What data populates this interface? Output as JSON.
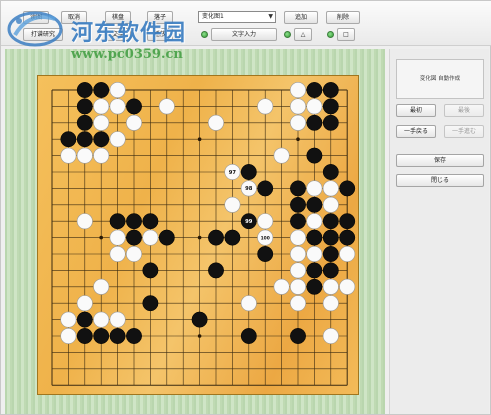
{
  "toolbar": {
    "btn_open": "读图",
    "btn_cancel": "取消",
    "btn_tab_a": "棋盘",
    "btn_tab_b": "打谱研究",
    "btn_tab_c": "落子",
    "btn_play": "播放",
    "btn_extra": "交手",
    "select_value": "变化图1",
    "btn_add": "追加",
    "btn_delete": "削除",
    "btn_text_input": "文字入力",
    "shape_triangle": "△",
    "shape_square": "□"
  },
  "watermark": {
    "title": "河东软件园",
    "url": "www.pc0359.cn"
  },
  "board": {
    "size": 19,
    "stones": [
      {
        "c": "b",
        "x": 2,
        "y": 0
      },
      {
        "c": "b",
        "x": 3,
        "y": 0
      },
      {
        "c": "w",
        "x": 4,
        "y": 0
      },
      {
        "c": "w",
        "x": 15,
        "y": 0
      },
      {
        "c": "b",
        "x": 16,
        "y": 0
      },
      {
        "c": "b",
        "x": 17,
        "y": 0
      },
      {
        "c": "b",
        "x": 2,
        "y": 1
      },
      {
        "c": "w",
        "x": 3,
        "y": 1
      },
      {
        "c": "w",
        "x": 4,
        "y": 1
      },
      {
        "c": "b",
        "x": 5,
        "y": 1
      },
      {
        "c": "w",
        "x": 7,
        "y": 1
      },
      {
        "c": "w",
        "x": 13,
        "y": 1
      },
      {
        "c": "w",
        "x": 15,
        "y": 1
      },
      {
        "c": "w",
        "x": 16,
        "y": 1
      },
      {
        "c": "b",
        "x": 17,
        "y": 1
      },
      {
        "c": "b",
        "x": 2,
        "y": 2
      },
      {
        "c": "w",
        "x": 3,
        "y": 2
      },
      {
        "c": "w",
        "x": 5,
        "y": 2
      },
      {
        "c": "w",
        "x": 10,
        "y": 2
      },
      {
        "c": "w",
        "x": 15,
        "y": 2
      },
      {
        "c": "b",
        "x": 16,
        "y": 2
      },
      {
        "c": "b",
        "x": 17,
        "y": 2
      },
      {
        "c": "b",
        "x": 1,
        "y": 3
      },
      {
        "c": "b",
        "x": 2,
        "y": 3
      },
      {
        "c": "b",
        "x": 3,
        "y": 3
      },
      {
        "c": "w",
        "x": 4,
        "y": 3
      },
      {
        "c": "w",
        "x": 1,
        "y": 4
      },
      {
        "c": "w",
        "x": 2,
        "y": 4
      },
      {
        "c": "w",
        "x": 3,
        "y": 4
      },
      {
        "c": "w",
        "x": 14,
        "y": 4
      },
      {
        "c": "b",
        "x": 16,
        "y": 4
      },
      {
        "c": "w",
        "x": 11,
        "y": 5
      },
      {
        "c": "b",
        "x": 12,
        "y": 5
      },
      {
        "c": "b",
        "x": 17,
        "y": 5
      },
      {
        "c": "w",
        "x": 12,
        "y": 6
      },
      {
        "c": "b",
        "x": 13,
        "y": 6
      },
      {
        "c": "b",
        "x": 15,
        "y": 6
      },
      {
        "c": "w",
        "x": 16,
        "y": 6
      },
      {
        "c": "w",
        "x": 17,
        "y": 6
      },
      {
        "c": "b",
        "x": 18,
        "y": 6
      },
      {
        "c": "w",
        "x": 11,
        "y": 7
      },
      {
        "c": "b",
        "x": 15,
        "y": 7
      },
      {
        "c": "b",
        "x": 16,
        "y": 7
      },
      {
        "c": "w",
        "x": 17,
        "y": 7
      },
      {
        "c": "w",
        "x": 2,
        "y": 8
      },
      {
        "c": "b",
        "x": 4,
        "y": 8
      },
      {
        "c": "b",
        "x": 5,
        "y": 8
      },
      {
        "c": "b",
        "x": 6,
        "y": 8
      },
      {
        "c": "b",
        "x": 12,
        "y": 8
      },
      {
        "c": "w",
        "x": 13,
        "y": 8
      },
      {
        "c": "b",
        "x": 15,
        "y": 8
      },
      {
        "c": "w",
        "x": 16,
        "y": 8
      },
      {
        "c": "b",
        "x": 17,
        "y": 8
      },
      {
        "c": "b",
        "x": 18,
        "y": 8
      },
      {
        "c": "w",
        "x": 4,
        "y": 9
      },
      {
        "c": "b",
        "x": 5,
        "y": 9
      },
      {
        "c": "w",
        "x": 6,
        "y": 9
      },
      {
        "c": "b",
        "x": 7,
        "y": 9
      },
      {
        "c": "b",
        "x": 10,
        "y": 9
      },
      {
        "c": "b",
        "x": 11,
        "y": 9
      },
      {
        "c": "w",
        "x": 13,
        "y": 9
      },
      {
        "c": "w",
        "x": 15,
        "y": 9
      },
      {
        "c": "b",
        "x": 16,
        "y": 9
      },
      {
        "c": "b",
        "x": 17,
        "y": 9
      },
      {
        "c": "b",
        "x": 18,
        "y": 9
      },
      {
        "c": "w",
        "x": 4,
        "y": 10
      },
      {
        "c": "w",
        "x": 5,
        "y": 10
      },
      {
        "c": "b",
        "x": 13,
        "y": 10
      },
      {
        "c": "w",
        "x": 15,
        "y": 10
      },
      {
        "c": "w",
        "x": 16,
        "y": 10
      },
      {
        "c": "b",
        "x": 17,
        "y": 10
      },
      {
        "c": "w",
        "x": 18,
        "y": 10
      },
      {
        "c": "b",
        "x": 6,
        "y": 11
      },
      {
        "c": "b",
        "x": 10,
        "y": 11
      },
      {
        "c": "w",
        "x": 15,
        "y": 11
      },
      {
        "c": "b",
        "x": 16,
        "y": 11
      },
      {
        "c": "b",
        "x": 17,
        "y": 11
      },
      {
        "c": "w",
        "x": 3,
        "y": 12
      },
      {
        "c": "w",
        "x": 14,
        "y": 12
      },
      {
        "c": "w",
        "x": 15,
        "y": 12
      },
      {
        "c": "b",
        "x": 16,
        "y": 12
      },
      {
        "c": "w",
        "x": 17,
        "y": 12
      },
      {
        "c": "w",
        "x": 18,
        "y": 12
      },
      {
        "c": "w",
        "x": 2,
        "y": 13
      },
      {
        "c": "b",
        "x": 6,
        "y": 13
      },
      {
        "c": "w",
        "x": 12,
        "y": 13
      },
      {
        "c": "w",
        "x": 15,
        "y": 13
      },
      {
        "c": "w",
        "x": 17,
        "y": 13
      },
      {
        "c": "w",
        "x": 1,
        "y": 14
      },
      {
        "c": "b",
        "x": 2,
        "y": 14
      },
      {
        "c": "w",
        "x": 3,
        "y": 14
      },
      {
        "c": "w",
        "x": 4,
        "y": 14
      },
      {
        "c": "b",
        "x": 9,
        "y": 14
      },
      {
        "c": "w",
        "x": 1,
        "y": 15
      },
      {
        "c": "b",
        "x": 2,
        "y": 15
      },
      {
        "c": "b",
        "x": 3,
        "y": 15
      },
      {
        "c": "b",
        "x": 4,
        "y": 15
      },
      {
        "c": "b",
        "x": 5,
        "y": 15
      },
      {
        "c": "b",
        "x": 12,
        "y": 15
      },
      {
        "c": "b",
        "x": 15,
        "y": 15
      },
      {
        "c": "w",
        "x": 17,
        "y": 15
      }
    ],
    "numbered": [
      {
        "n": "97",
        "x": 11,
        "y": 5,
        "c": "w"
      },
      {
        "n": "98",
        "x": 12,
        "y": 6,
        "c": "w"
      },
      {
        "n": "99",
        "x": 12,
        "y": 8,
        "c": "b"
      },
      {
        "n": "100",
        "x": 13,
        "y": 9,
        "c": "w"
      }
    ]
  },
  "panel": {
    "info_text": "変化図 自動作成",
    "btn_first": "最初",
    "btn_last": "最後",
    "btn_prev": "一手戻る",
    "btn_next": "一手進む",
    "btn_save": "保存",
    "btn_close": "閉じる"
  }
}
